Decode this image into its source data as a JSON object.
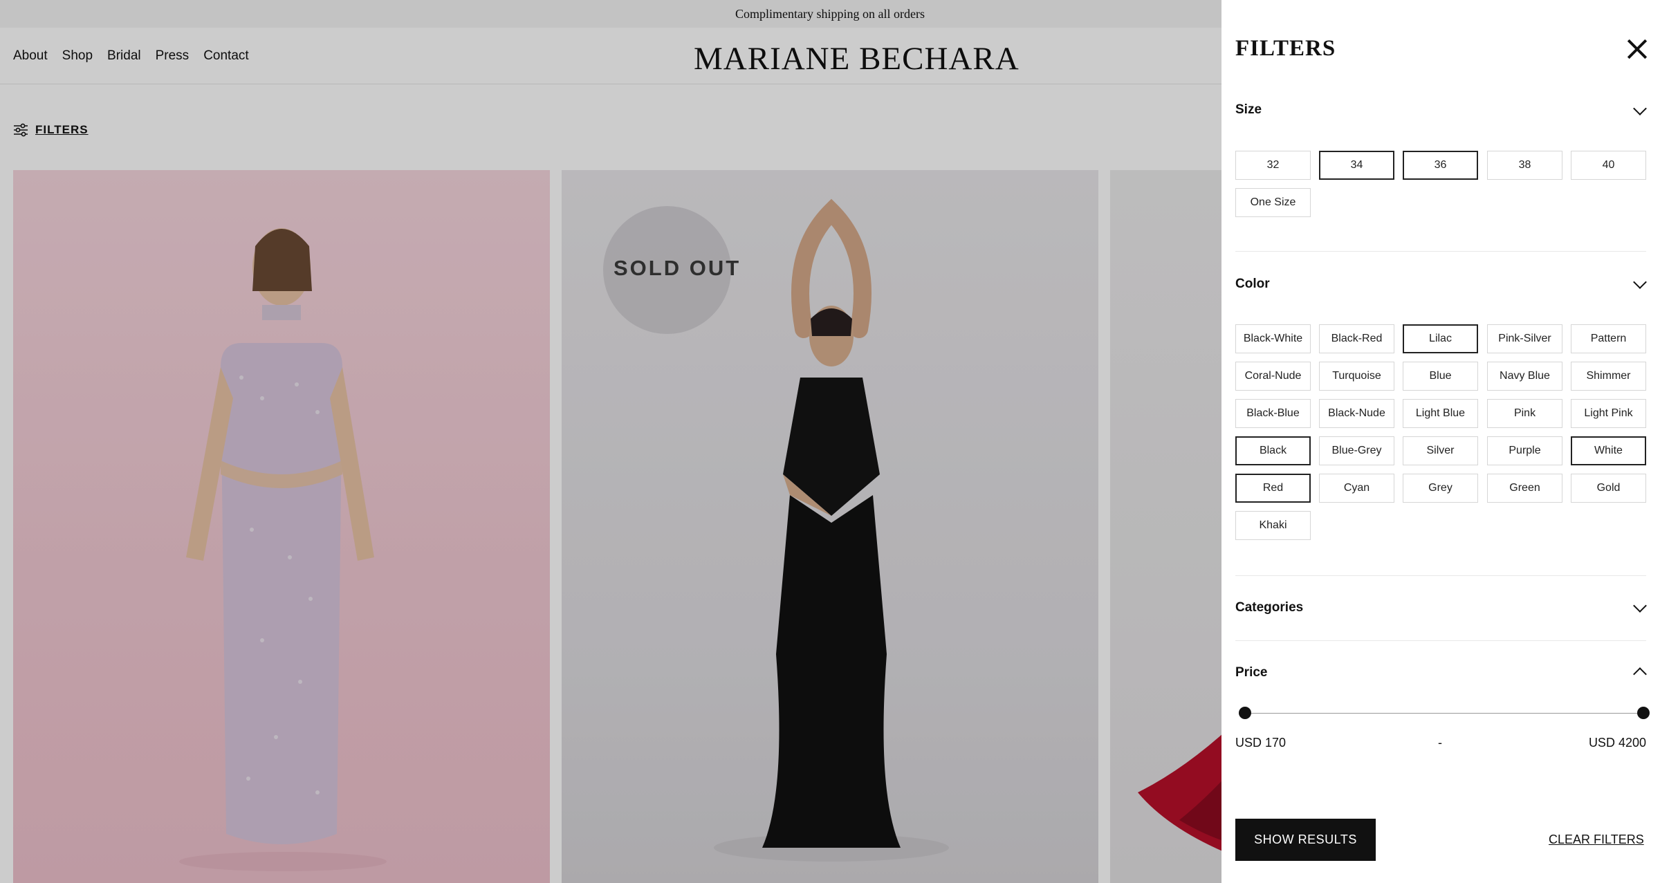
{
  "announcement": "Complimentary shipping on all orders",
  "header": {
    "nav": [
      "About",
      "Shop",
      "Bridal",
      "Press",
      "Contact"
    ],
    "logo": "MARIANE BECHARA"
  },
  "toolbar": {
    "filters_label": "FILTERS"
  },
  "products": [
    {
      "badge": ""
    },
    {
      "badge": "SOLD OUT"
    },
    {
      "badge": ""
    }
  ],
  "drawer": {
    "title": "FILTERS",
    "size": {
      "title": "Size",
      "options": [
        {
          "label": "32",
          "selected": false
        },
        {
          "label": "34",
          "selected": true
        },
        {
          "label": "36",
          "selected": true
        },
        {
          "label": "38",
          "selected": false
        },
        {
          "label": "40",
          "selected": false
        },
        {
          "label": "One Size",
          "selected": false
        }
      ]
    },
    "color": {
      "title": "Color",
      "options": [
        {
          "label": "Black-White",
          "selected": false
        },
        {
          "label": "Black-Red",
          "selected": false
        },
        {
          "label": "Lilac",
          "selected": true
        },
        {
          "label": "Pink-Silver",
          "selected": false
        },
        {
          "label": "Pattern",
          "selected": false
        },
        {
          "label": "Coral-Nude",
          "selected": false
        },
        {
          "label": "Turquoise",
          "selected": false
        },
        {
          "label": "Blue",
          "selected": false
        },
        {
          "label": "Navy Blue",
          "selected": false
        },
        {
          "label": "Shimmer",
          "selected": false
        },
        {
          "label": "Black-Blue",
          "selected": false
        },
        {
          "label": "Black-Nude",
          "selected": false
        },
        {
          "label": "Light Blue",
          "selected": false
        },
        {
          "label": "Pink",
          "selected": false
        },
        {
          "label": "Light Pink",
          "selected": false
        },
        {
          "label": "Black",
          "selected": true
        },
        {
          "label": "Blue-Grey",
          "selected": false
        },
        {
          "label": "Silver",
          "selected": false
        },
        {
          "label": "Purple",
          "selected": false
        },
        {
          "label": "White",
          "selected": true
        },
        {
          "label": "Red",
          "selected": true
        },
        {
          "label": "Cyan",
          "selected": false
        },
        {
          "label": "Grey",
          "selected": false
        },
        {
          "label": "Green",
          "selected": false
        },
        {
          "label": "Gold",
          "selected": false
        },
        {
          "label": "Khaki",
          "selected": false
        }
      ]
    },
    "categories": {
      "title": "Categories"
    },
    "price": {
      "title": "Price",
      "min": "USD 170",
      "separator": "-",
      "max": "USD 4200"
    },
    "show_results": "SHOW RESULTS",
    "clear_filters": "CLEAR FILTERS"
  },
  "icons": {
    "close": "close-icon",
    "filters": "sliders-icon",
    "collapse": "chevron-down-icon",
    "expand": "chevron-up-icon"
  }
}
